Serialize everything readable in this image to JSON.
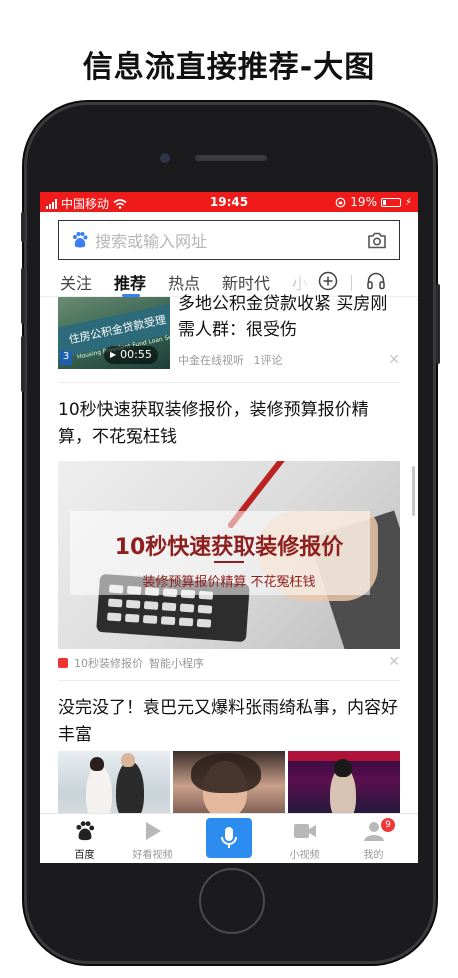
{
  "page_title": "信息流直接推荐-大图",
  "status_bar": {
    "carrier": "中国移动",
    "time": "19:45",
    "battery": "19%",
    "battery_level": 0.19
  },
  "search": {
    "placeholder": "搜索或输入网址"
  },
  "tabs": [
    {
      "label": "关注"
    },
    {
      "label": "推荐",
      "active": true
    },
    {
      "label": "热点"
    },
    {
      "label": "新时代"
    },
    {
      "label": "小"
    }
  ],
  "feed": {
    "card1": {
      "title": "多地公积金贷款收紧 买房刚需人群：很受伤",
      "duration": "00:55",
      "source": "中金在线视听",
      "comments": "1评论",
      "image_text": "住房公积金贷款受理",
      "image_sub": "Housing Provident Fund Loan Servi",
      "image_num": "3"
    },
    "card2": {
      "title": "10秒快速获取装修报价，装修预算报价精算，不花冤枉钱",
      "image_headline": "10秒快速获取装修报价",
      "image_sub": "装修预算报价精算 不花冤枉钱",
      "source": "10秒装修报价",
      "tag": "智能小程序"
    },
    "card3": {
      "title": "没完没了！袁巴元又爆料张雨绮私事，内容好丰富"
    }
  },
  "tabbar": [
    {
      "label": "百度",
      "icon": "baidu-paw-icon",
      "active": true
    },
    {
      "label": "好看视频",
      "icon": "play-icon"
    },
    {
      "label": "",
      "icon": "microphone-icon"
    },
    {
      "label": "小视频",
      "icon": "video-camera-icon"
    },
    {
      "label": "我的",
      "icon": "user-icon",
      "badge": "9"
    }
  ],
  "colors": {
    "status_bar": "#ef1b1b",
    "accent": "#3a7ff6",
    "mic_button": "#2d8cf0",
    "badge": "#f03838"
  }
}
